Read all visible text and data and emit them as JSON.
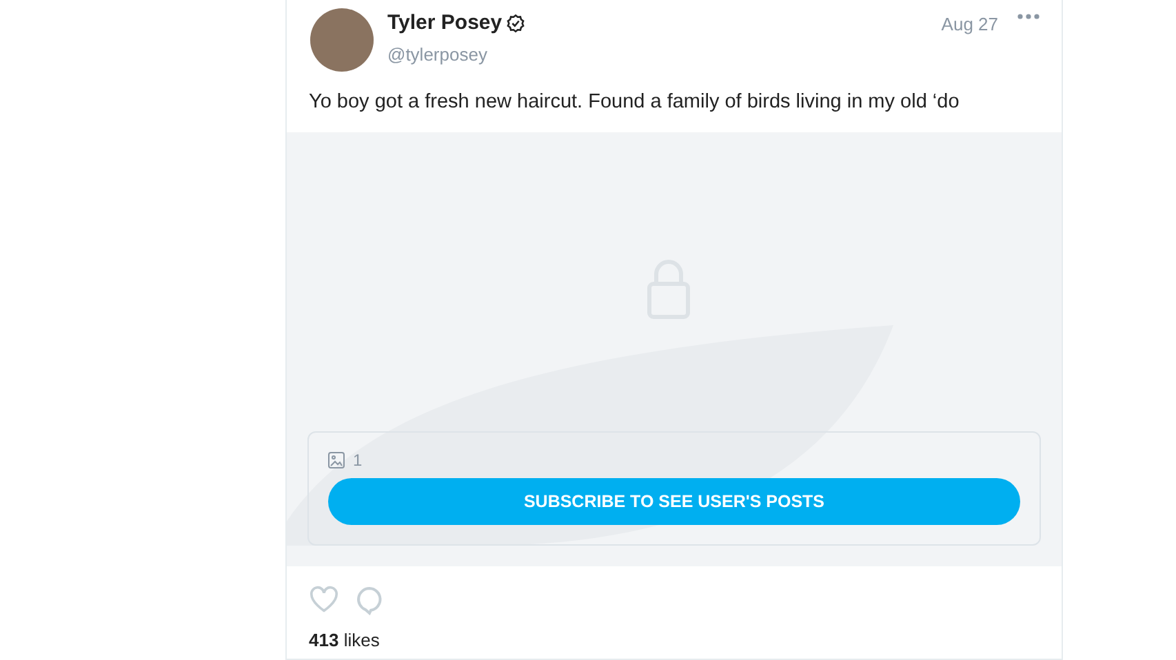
{
  "post": {
    "author": {
      "name": "Tyler Posey",
      "verified": true,
      "handle": "@tylerposey"
    },
    "date": "Aug 27",
    "text": "Yo boy got a fresh new haircut. Found a family of birds living in my old ‘do",
    "media": {
      "count": "1",
      "button": "SUBSCRIBE TO SEE USER'S POSTS"
    },
    "likes": "**413** likes"
  }
}
